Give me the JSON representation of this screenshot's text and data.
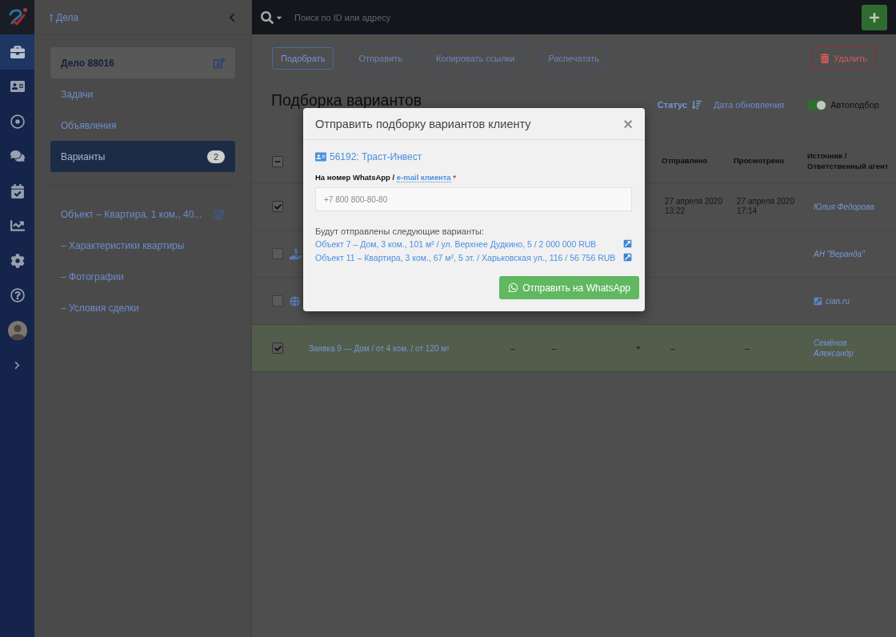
{
  "nav_rail": {
    "items": [
      {
        "selected": true
      },
      {
        "selected": false
      },
      {
        "selected": false
      },
      {
        "selected": false
      },
      {
        "selected": false
      },
      {
        "selected": false
      },
      {
        "selected": false
      },
      {
        "selected": false
      }
    ]
  },
  "case_panel": {
    "back_label": "Дела",
    "items": [
      {
        "kind": "case",
        "label": "Дело 88016",
        "selected": false
      },
      {
        "kind": "link",
        "label": "Задачи",
        "selected": false
      },
      {
        "kind": "link",
        "label": "Объявления",
        "selected": false
      },
      {
        "kind": "link",
        "label": "Варианты",
        "selected": true,
        "badge": "2"
      }
    ],
    "object": {
      "label": "Объект – Квартира, 1 ком., 40...",
      "children": [
        {
          "label": "– Характеристики квартиры"
        },
        {
          "label": "– Фотографии"
        },
        {
          "label": "– Условия сделки"
        }
      ]
    }
  },
  "search": {
    "placeholder": "Поиск по ID или адресу"
  },
  "toolbar": {
    "buttons": [
      {
        "label": "Подобрать",
        "kind": "primary"
      },
      {
        "label": "Отправить",
        "kind": "outline"
      },
      {
        "label": "Копировать ссылки",
        "kind": "outline"
      },
      {
        "label": "Распечатать",
        "kind": "outline"
      },
      {
        "label": "Удалить",
        "kind": "danger"
      }
    ]
  },
  "page_title": "Подборка вариантов",
  "sort": [
    {
      "label": "Статус",
      "selected": true
    },
    {
      "label": "Дата обновления",
      "selected": false
    }
  ],
  "auto_select": {
    "label": "Автоподбор",
    "on": true
  },
  "table": {
    "header_checkbox": {
      "indeterminate": true
    },
    "columns": [
      {
        "label": "Отправлено"
      },
      {
        "label": "Просмотрено"
      },
      {
        "label": "Источник / Ответственный агент"
      }
    ],
    "rows": [
      {
        "kind": "variant",
        "checked": true,
        "highlighted": false,
        "sent": {
          "date": "27 апреля 2020",
          "time": "13:22"
        },
        "viewed": {
          "date": "27 апреля 2020",
          "time": "17:14"
        },
        "agent": "Юлия Федорова"
      },
      {
        "kind": "agency",
        "checked": false,
        "highlighted": false,
        "agent": "АН \"Веранда\""
      },
      {
        "kind": "website",
        "checked": false,
        "highlighted": false,
        "agent": "cian.ru"
      },
      {
        "kind": "request",
        "checked": true,
        "highlighted": true,
        "title": "Заявка 9 — Дом / от 4 ком. / от 120 м²",
        "cells": [
          "–",
          "–"
        ],
        "has_menu": true,
        "sent": {
          "date": "–"
        },
        "viewed": {
          "date": "–"
        },
        "agent": "Семёнов Александр"
      }
    ]
  },
  "modal": {
    "title": "Отправить подборку вариантов клиенту",
    "close": "×",
    "client": "56192: Траст-Инвест",
    "field_label": "На номер WhatsApp /",
    "field_link": "e-mail клиента",
    "required_mark": "*",
    "input": {
      "placeholder": "+7 800 800-80-80"
    },
    "list_label": "Будут отправлены следующие варианты:",
    "variants": [
      "Объект 7 – Дом, 3 ком., 101 м² / ул. Верхнее Дудкино, 5 / 2 000 000 RUB",
      "Объект 11 – Квартира, 3 ком., 67 м², 5 эт. / Харьковская ул., 116 / 56 756 RUB"
    ],
    "submit": "Отправить на WhatsApp"
  }
}
